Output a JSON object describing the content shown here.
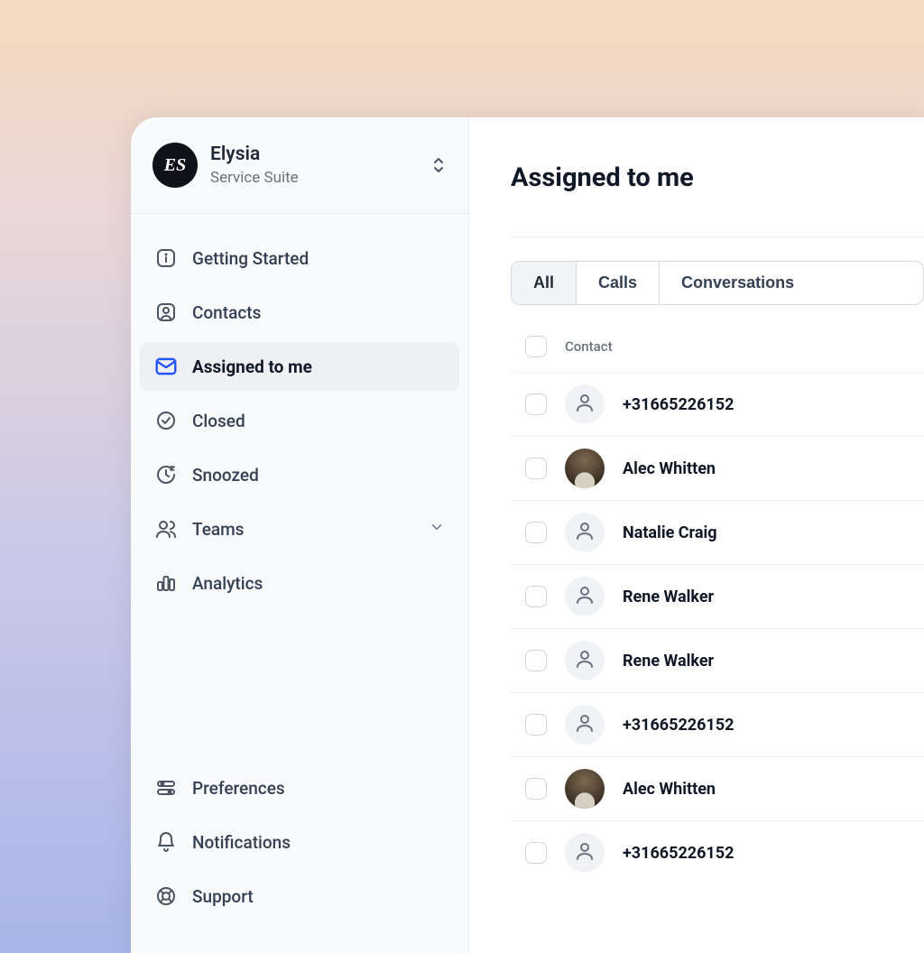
{
  "workspace": {
    "name": "Elysia",
    "subtitle": "Service Suite",
    "logo_text": "ES"
  },
  "nav": {
    "items": [
      {
        "label": "Getting Started",
        "icon": "info"
      },
      {
        "label": "Contacts",
        "icon": "contact"
      },
      {
        "label": "Assigned to me",
        "icon": "mail",
        "active": true
      },
      {
        "label": "Closed",
        "icon": "check-circle"
      },
      {
        "label": "Snoozed",
        "icon": "clock-snooze"
      },
      {
        "label": "Teams",
        "icon": "users",
        "expandable": true
      },
      {
        "label": "Analytics",
        "icon": "bar-chart"
      }
    ],
    "footer": [
      {
        "label": "Preferences",
        "icon": "sliders"
      },
      {
        "label": "Notifications",
        "icon": "bell"
      },
      {
        "label": "Support",
        "icon": "lifebuoy"
      }
    ]
  },
  "page": {
    "title": "Assigned to me"
  },
  "tabs": [
    {
      "label": "All",
      "active": true
    },
    {
      "label": "Calls"
    },
    {
      "label": "Conversations"
    }
  ],
  "table": {
    "column_label": "Contact",
    "rows": [
      {
        "name": "+31665226152",
        "avatar": "placeholder"
      },
      {
        "name": "Alec Whitten",
        "avatar": "photo"
      },
      {
        "name": "Natalie Craig",
        "avatar": "placeholder"
      },
      {
        "name": "Rene Walker",
        "avatar": "placeholder"
      },
      {
        "name": "Rene Walker",
        "avatar": "placeholder"
      },
      {
        "name": "+31665226152",
        "avatar": "placeholder"
      },
      {
        "name": "Alec Whitten",
        "avatar": "photo"
      },
      {
        "name": "+31665226152",
        "avatar": "placeholder"
      }
    ]
  }
}
